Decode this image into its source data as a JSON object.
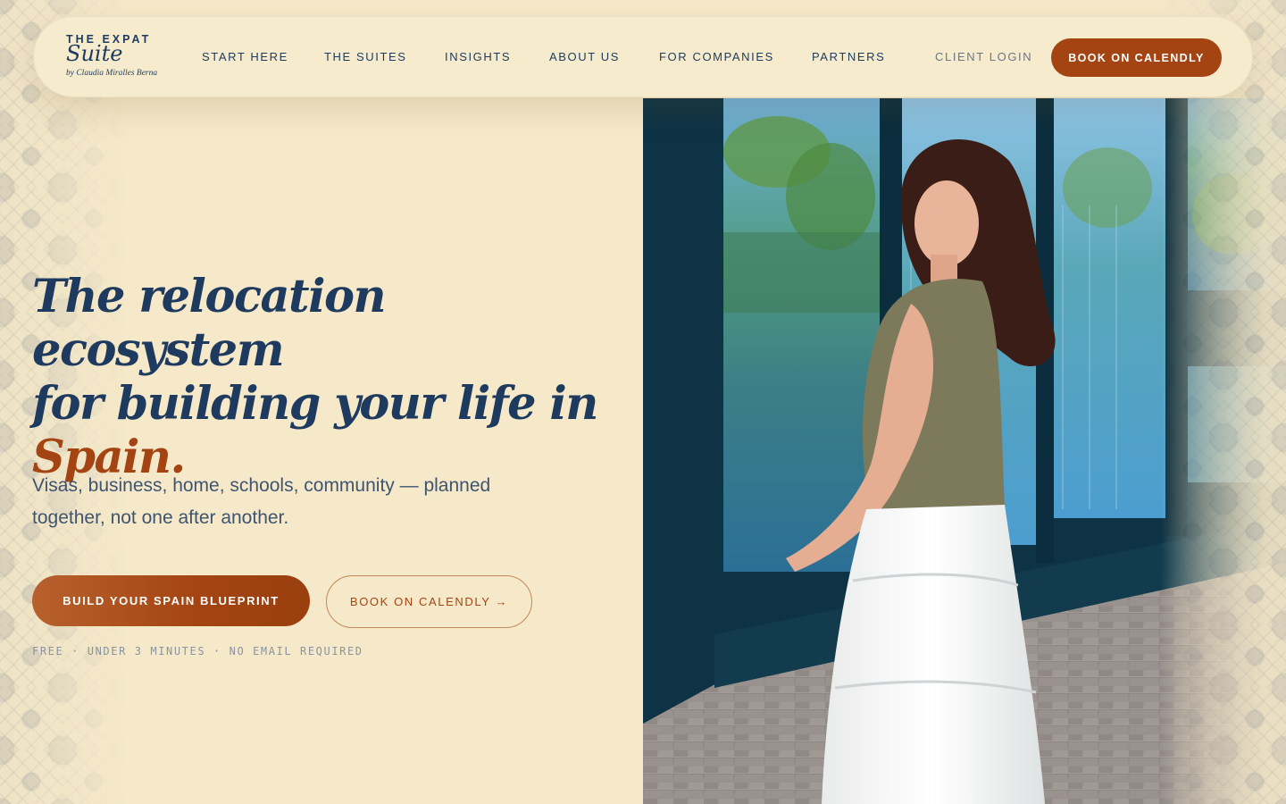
{
  "brand": {
    "line1": "THE EXPAT",
    "line2": "Suite",
    "byline": "by Claudia Miralles Berna"
  },
  "nav": {
    "items": [
      {
        "label": "START HERE"
      },
      {
        "label": "THE SUITES"
      },
      {
        "label": "INSIGHTS"
      },
      {
        "label": "ABOUT US"
      },
      {
        "label": "FOR COMPANIES"
      },
      {
        "label": "PARTNERS"
      }
    ],
    "client_login": "CLIENT LOGIN",
    "cta": "BOOK ON CALENDLY"
  },
  "hero": {
    "headline_line1": "The relocation ecosystem",
    "headline_line2": "for building your life in",
    "headline_accent": "Spain.",
    "subhead": "Visas, business, home, schools, community — planned together, not one after another.",
    "primary_cta": "BUILD YOUR SPAIN BLUEPRINT",
    "secondary_cta": "BOOK ON CALENDLY →",
    "fineprint": "FREE · UNDER 3 MINUTES · NO EMAIL REQUIRED"
  },
  "colors": {
    "background": "#f5e9c9",
    "navy": "#1e3a5f",
    "accent": "#a44412"
  }
}
